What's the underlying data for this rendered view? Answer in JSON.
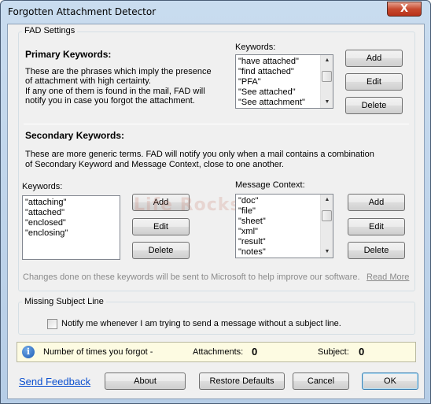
{
  "window": {
    "title": "Forgotten Attachment Detector",
    "close_label": "X"
  },
  "fad_settings": {
    "group_title": "FAD Settings",
    "primary": {
      "heading": "Primary Keywords:",
      "desc_line1": "These are the phrases which imply the presence",
      "desc_line2": "of attachment with high certainty.",
      "desc_line3": "If any one of them is found in the mail, FAD will",
      "desc_line4": "notify you in case you forgot the attachment.",
      "list_label": "Keywords:",
      "items": [
        "\"have attached\"",
        "\"find attached\"",
        "\"PFA\"",
        "\"See attached\"",
        "\"See attachment\""
      ],
      "add_label": "Add",
      "edit_label": "Edit",
      "delete_label": "Delete"
    },
    "secondary": {
      "heading": "Secondary Keywords:",
      "desc_line1": "These are more generic terms. FAD will notify you only when a mail contains a combination",
      "desc_line2": "of Secondary Keyword and Message Context, close to one another.",
      "keywords_label": "Keywords:",
      "keywords": [
        "\"attaching\"",
        "\"attached\"",
        "\"enclosed\"",
        "\"enclosing\""
      ],
      "context_label": "Message Context:",
      "context": [
        "\"doc\"",
        "\"file\"",
        "\"sheet\"",
        "\"xml\"",
        "\"result\"",
        "\"notes\""
      ],
      "add_label": "Add",
      "edit_label": "Edit",
      "delete_label": "Delete"
    },
    "notice": "Changes done on these keywords will be sent to Microsoft to help improve our software.",
    "read_more": "Read More",
    "watermark": "Life Rocks 2.0"
  },
  "missing_subject": {
    "group_title": "Missing Subject Line",
    "checkbox_label": "Notify me whenever I am trying to send a message without a subject line.",
    "checked": false
  },
  "stats": {
    "label": "Number of times you forgot -",
    "attachments_label": "Attachments:",
    "attachments_value": "0",
    "subject_label": "Subject:",
    "subject_value": "0"
  },
  "footer": {
    "send_feedback": "Send Feedback",
    "about": "About",
    "restore": "Restore Defaults",
    "cancel": "Cancel",
    "ok": "OK"
  }
}
